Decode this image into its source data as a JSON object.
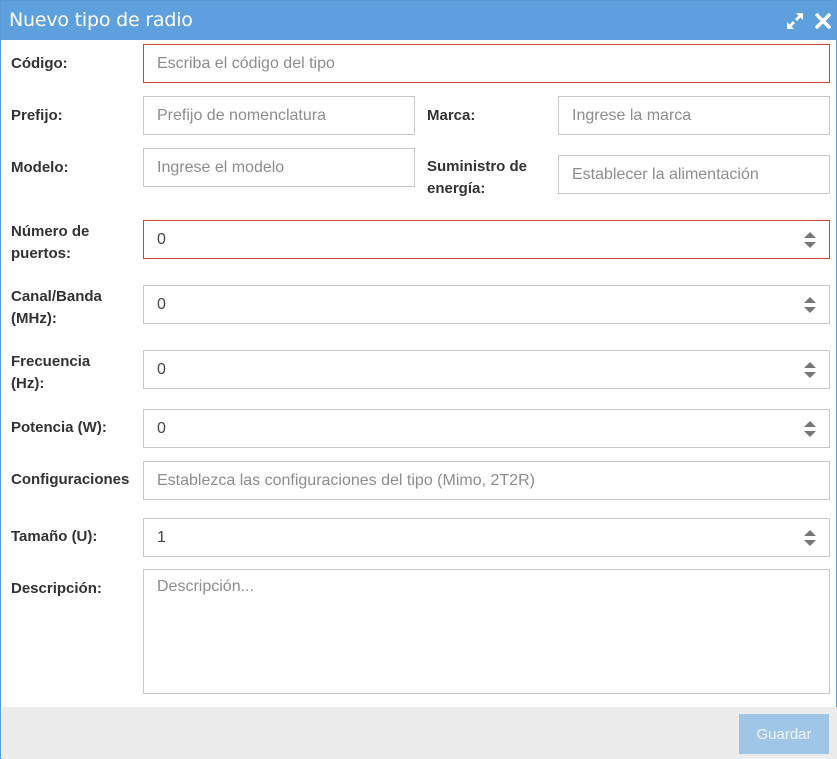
{
  "dialog": {
    "title": "Nuevo tipo de radio",
    "title_bar_color": "#5e9fdd",
    "icons": [
      "expand-icon",
      "close-icon"
    ]
  },
  "form": {
    "codigo": {
      "label": "Código:",
      "placeholder": "Escriba el código del tipo",
      "value": ""
    },
    "prefijo": {
      "label": "Prefijo:",
      "placeholder": "Prefijo de nomenclatura",
      "value": ""
    },
    "marca": {
      "label": "Marca:",
      "placeholder": "Ingrese la marca",
      "value": ""
    },
    "modelo": {
      "label": "Modelo:",
      "placeholder": "Ingrese el modelo",
      "value": ""
    },
    "suministro": {
      "label_line1": "Suministro de",
      "label_line2": "energía:",
      "placeholder": "Establecer la alimentación",
      "value": ""
    },
    "puertos": {
      "label_line1": "Número de",
      "label_line2": "puertos:",
      "value": "0"
    },
    "canal": {
      "label_line1": "Canal/Banda",
      "label_line2": "(MHz):",
      "value": "0"
    },
    "frecuencia": {
      "label_line1": "Frecuencia",
      "label_line2": "(Hz):",
      "value": "0"
    },
    "potencia": {
      "label": "Potencia (W):",
      "value": "0"
    },
    "configuraciones": {
      "label": "Configuraciones",
      "placeholder": "Establezca las configuraciones del tipo (Mimo, 2T2R)",
      "value": ""
    },
    "tamano": {
      "label": "Tamaño (U):",
      "value": "1"
    },
    "descripcion": {
      "label": "Descripción:",
      "placeholder": "Descripción...",
      "value": ""
    }
  },
  "footer": {
    "save_label": "Guardar"
  },
  "colors": {
    "error_border": "#c9463d",
    "save_button": "#9fc6e7"
  }
}
